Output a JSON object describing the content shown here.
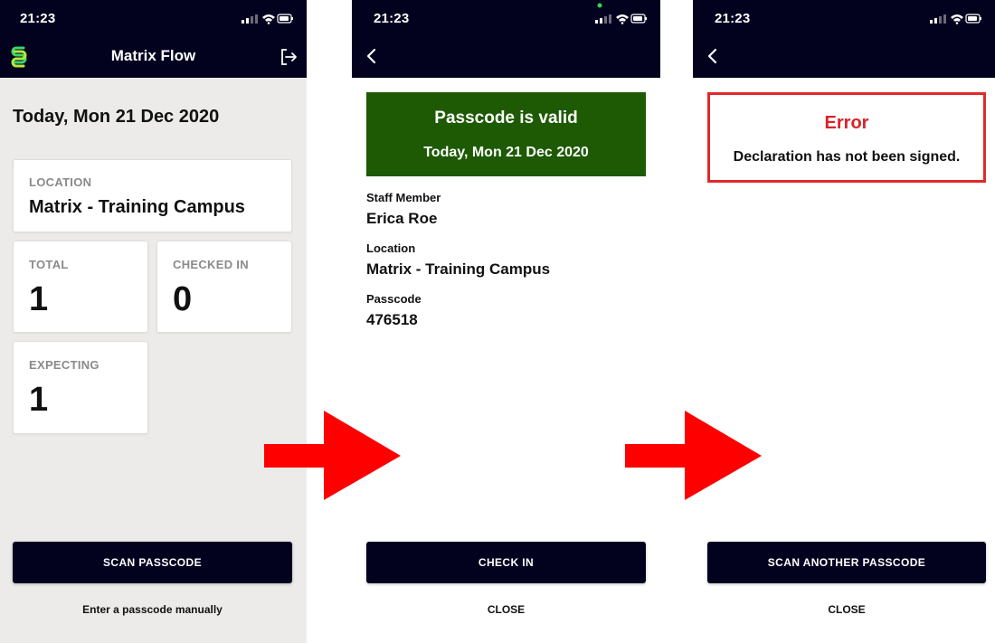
{
  "colors": {
    "nav_bar": "#02021f",
    "valid_green": "#1d5a03",
    "error_red": "#d8232a",
    "arrow_red": "#ff0000",
    "screen1_bg": "#ecebe9"
  },
  "screen_home": {
    "time": "21:23",
    "app_title": "Matrix Flow",
    "logo_icon": "matrix-logo-icon",
    "logout_icon": "logout-icon",
    "date_heading": "Today, Mon 21 Dec 2020",
    "location": {
      "label": "LOCATION",
      "value": "Matrix - Training Campus"
    },
    "total": {
      "label": "TOTAL",
      "value": "1"
    },
    "checked_in": {
      "label": "CHECKED IN",
      "value": "0"
    },
    "expecting": {
      "label": "EXPECTING",
      "value": "1"
    },
    "scan_button": "SCAN PASSCODE",
    "manual_link": "Enter a passcode manually"
  },
  "screen_valid": {
    "time": "21:23",
    "back_icon": "chevron-left-icon",
    "banner_title": "Passcode is valid",
    "banner_date": "Today, Mon 21 Dec 2020",
    "staff_label": "Staff Member",
    "staff_value": "Erica Roe",
    "location_label": "Location",
    "location_value": "Matrix - Training Campus",
    "passcode_label": "Passcode",
    "passcode_value": "476518",
    "check_in_button": "CHECK IN",
    "close_link": "CLOSE"
  },
  "screen_error": {
    "time": "21:23",
    "back_icon": "chevron-left-icon",
    "error_title": "Error",
    "error_message": "Declaration has not been signed.",
    "scan_another_button": "SCAN ANOTHER PASSCODE",
    "close_link": "CLOSE"
  }
}
